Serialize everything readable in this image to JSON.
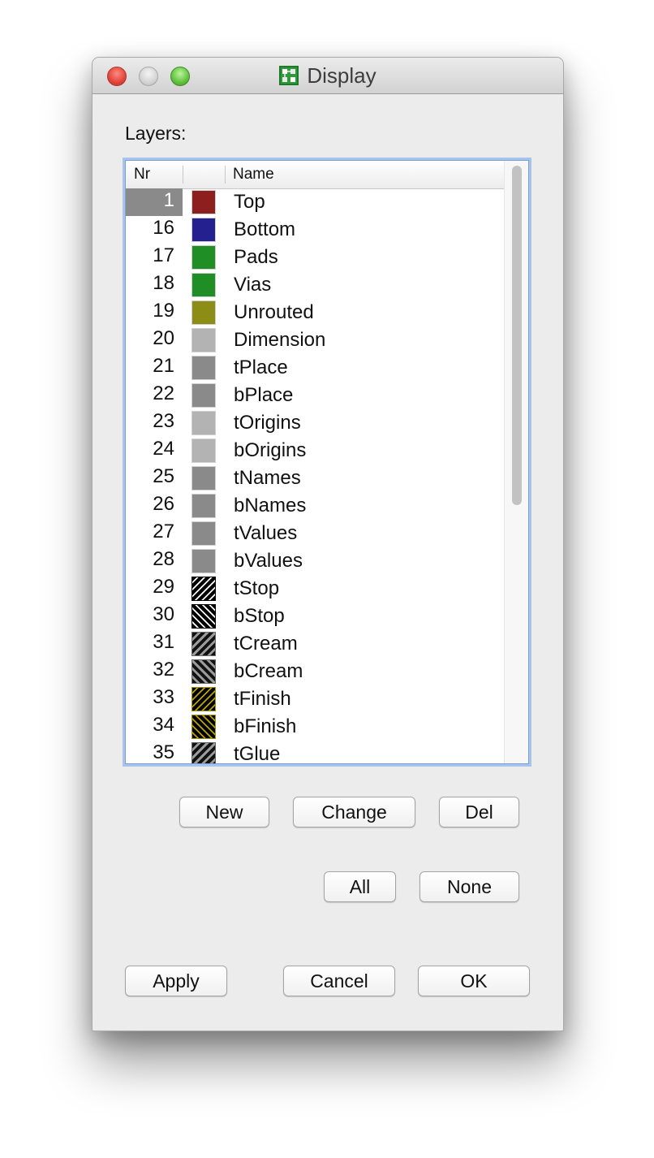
{
  "window": {
    "title": "Display",
    "app_icon": "board-icon"
  },
  "layers_label": "Layers:",
  "list": {
    "headers": {
      "nr": "Nr",
      "color": "",
      "name": "Name"
    },
    "rows": [
      {
        "nr": "1",
        "name": "Top",
        "color": "#8e1f1f",
        "pattern": "solid",
        "selected": true
      },
      {
        "nr": "16",
        "name": "Bottom",
        "color": "#25208f",
        "pattern": "solid"
      },
      {
        "nr": "17",
        "name": "Pads",
        "color": "#1f8e24",
        "pattern": "solid"
      },
      {
        "nr": "18",
        "name": "Vias",
        "color": "#1f8e24",
        "pattern": "solid"
      },
      {
        "nr": "19",
        "name": "Unrouted",
        "color": "#8b8d14",
        "pattern": "solid"
      },
      {
        "nr": "20",
        "name": "Dimension",
        "color": "#b3b3b3",
        "pattern": "solid"
      },
      {
        "nr": "21",
        "name": "tPlace",
        "color": "#8a8a8a",
        "pattern": "solid"
      },
      {
        "nr": "22",
        "name": "bPlace",
        "color": "#8a8a8a",
        "pattern": "solid"
      },
      {
        "nr": "23",
        "name": "tOrigins",
        "color": "#b3b3b3",
        "pattern": "solid"
      },
      {
        "nr": "24",
        "name": "bOrigins",
        "color": "#b3b3b3",
        "pattern": "solid"
      },
      {
        "nr": "25",
        "name": "tNames",
        "color": "#8a8a8a",
        "pattern": "solid"
      },
      {
        "nr": "26",
        "name": "bNames",
        "color": "#8a8a8a",
        "pattern": "solid"
      },
      {
        "nr": "27",
        "name": "tValues",
        "color": "#8a8a8a",
        "pattern": "solid"
      },
      {
        "nr": "28",
        "name": "bValues",
        "color": "#8a8a8a",
        "pattern": "solid"
      },
      {
        "nr": "29",
        "name": "tStop",
        "color": "#000000",
        "pattern": "hatch-f"
      },
      {
        "nr": "30",
        "name": "bStop",
        "color": "#000000",
        "pattern": "hatch-b"
      },
      {
        "nr": "31",
        "name": "tCream",
        "color": "#9a9a9a",
        "pattern": "hatch-gf"
      },
      {
        "nr": "32",
        "name": "bCream",
        "color": "#9a9a9a",
        "pattern": "hatch-gb"
      },
      {
        "nr": "33",
        "name": "tFinish",
        "color": "#b8a400",
        "pattern": "hatch-yf"
      },
      {
        "nr": "34",
        "name": "bFinish",
        "color": "#b8a400",
        "pattern": "hatch-yb"
      },
      {
        "nr": "35",
        "name": "tGlue",
        "color": "#9a9a9a",
        "pattern": "hatch-gf"
      }
    ]
  },
  "buttons": {
    "new": "New",
    "change": "Change",
    "del": "Del",
    "all": "All",
    "none": "None",
    "apply": "Apply",
    "cancel": "Cancel",
    "ok": "OK"
  }
}
